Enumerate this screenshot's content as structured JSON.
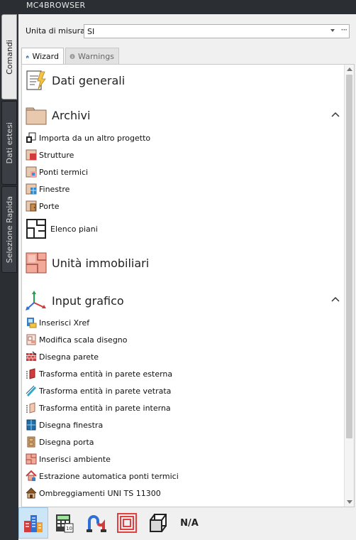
{
  "window": {
    "title": "MC4BROWSER"
  },
  "side_tabs": [
    "Comandi",
    "Dati estesi",
    "Selezione Rapida"
  ],
  "unit": {
    "label": "Unita di misura",
    "value": "SI"
  },
  "tabs": [
    {
      "label": "Wizard",
      "icon": "home-icon"
    },
    {
      "label": "Warnings",
      "icon": "info-icon"
    }
  ],
  "sections": {
    "dati_generali": "Dati generali",
    "archivi": "Archivi",
    "unita": "Unità immobiliari",
    "input_grafico": "Input grafico"
  },
  "archivi_items": [
    "Importa da un altro progetto",
    "Strutture",
    "Ponti termici",
    "Finestre",
    "Porte",
    "Elenco piani"
  ],
  "input_items": [
    "Inserisci Xref",
    "Modifica scala disegno",
    "Disegna parete",
    "Trasforma entità in parete esterna",
    "Trasforma entità in parete vetrata",
    "Trasforma entità in parete interna",
    "Disegna finestra",
    "Disegna porta",
    "Inserisci ambiente",
    "Estrazione automatica ponti termici",
    "Ombreggiamenti UNI TS 11300"
  ],
  "bottom": {
    "na_label": "N/A"
  },
  "colors": {
    "accent": "#cde6f7",
    "panel": "#f0f0f0",
    "chrome": "#2b2e33"
  }
}
